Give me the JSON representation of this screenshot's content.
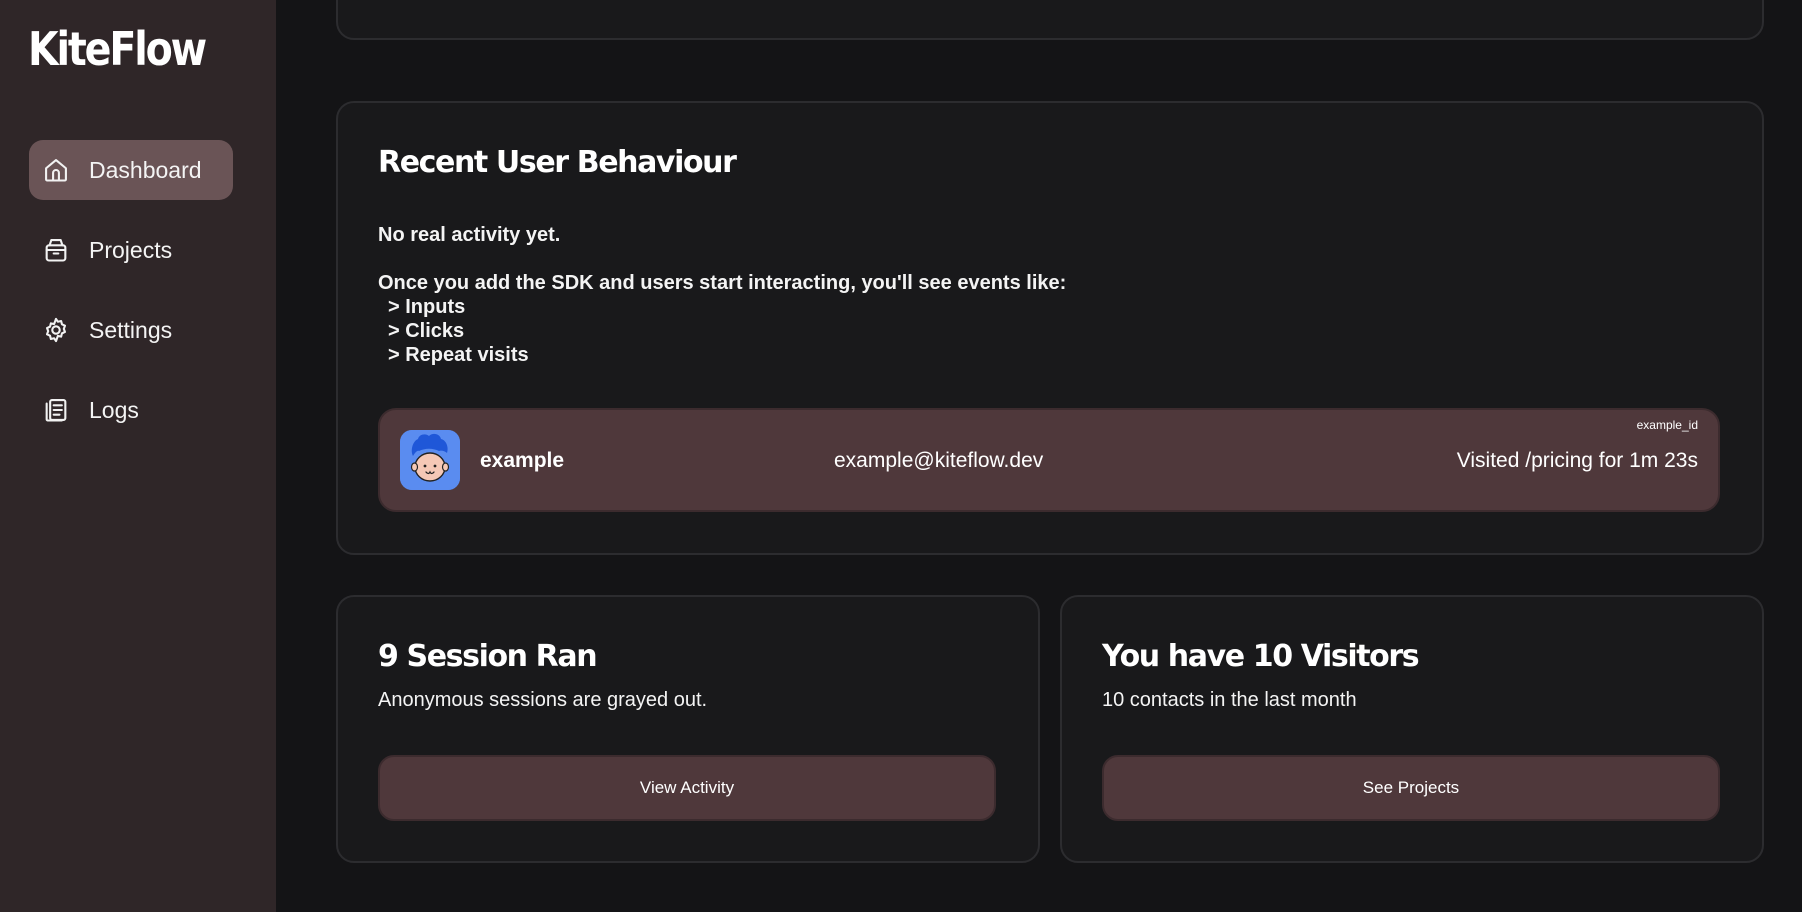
{
  "app": {
    "brand": "KiteFlow"
  },
  "sidebar": {
    "items": [
      {
        "label": "Dashboard",
        "icon": "home-icon",
        "active": true
      },
      {
        "label": "Projects",
        "icon": "box-icon",
        "active": false
      },
      {
        "label": "Settings",
        "icon": "gear-icon",
        "active": false
      },
      {
        "label": "Logs",
        "icon": "document-icon",
        "active": false
      }
    ]
  },
  "behaviour": {
    "title": "Recent User Behaviour",
    "no_activity": "No real activity yet.",
    "intro": "Once you add the SDK and users start interacting, you'll see events like:",
    "events": [
      "> Inputs",
      "> Clicks",
      "> Repeat visits"
    ],
    "example_user": {
      "name": "example",
      "email": "example@kiteflow.dev",
      "activity": "Visited /pricing for 1m 23s",
      "id": "example_id",
      "avatar": "cartoon-face-avatar"
    }
  },
  "sessions": {
    "title": "9 Session Ran",
    "subtitle": "Anonymous sessions are grayed out.",
    "button": "View Activity"
  },
  "visitors": {
    "title": "You have 10 Visitors",
    "subtitle": "10 contacts in the last month",
    "button": "See Projects"
  },
  "colors": {
    "background": "#141416",
    "sidebar": "#2f2628",
    "active_nav": "#6a5456",
    "card": "#19191b",
    "accent_row": "#4f383b"
  }
}
